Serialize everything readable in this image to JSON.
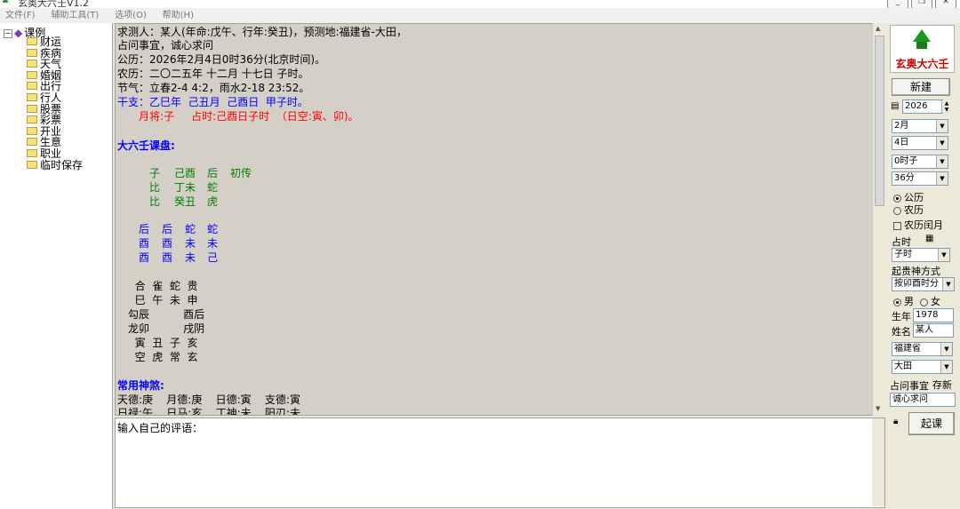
{
  "window": {
    "title": "玄奥大六壬V1.2"
  },
  "menu": {
    "items": [
      "文件(F)",
      "辅助工具(T)",
      "选项(O)",
      "帮助(H)"
    ]
  },
  "tree": {
    "root": "课例",
    "items": [
      "财运",
      "疾病",
      "天气",
      "婚姻",
      "出行",
      "行人",
      "股票",
      "彩票",
      "开业",
      "生意",
      "职业",
      "临时保存"
    ]
  },
  "content": {
    "intro": [
      "求测人：某人(年命:戊午、行年:癸丑)，预测地:福建省-大田，",
      "占问事宜，诚心求问",
      "公历：2026年2月4日0时36分(北京时间)。",
      "农历：二〇二五年 十二月 十七日 子时。",
      "节气：立春2-4 4:2，雨水2-18 23:52。"
    ],
    "ganzhi": "干支：乙巳年  己丑月  己酉日  甲子时。",
    "yuejiang": "月将:子     占时:己酉日子时  （日空:寅、卯)。",
    "pan_title": "大六壬课盘:",
    "chuan": [
      [
        "子",
        "己酉",
        "后",
        "初传"
      ],
      [
        "比",
        "丁未",
        "蛇",
        ""
      ],
      [
        "比",
        "癸丑",
        "虎",
        ""
      ]
    ],
    "ke": [
      [
        "后",
        "后",
        "蛇",
        "蛇"
      ],
      [
        "酉",
        "酉",
        "未",
        "未"
      ],
      [
        "酉",
        "酉",
        "未",
        "己"
      ]
    ],
    "tianpan": [
      "  合  雀  蛇  贵",
      "  巳  午  未  申",
      "勾辰          酉后",
      "龙卯          戌阴",
      "  寅  丑  子  亥",
      "  空  虎  常  玄"
    ],
    "shensha_title": "常用神煞:",
    "shensha": [
      "天德:庚    月德:庚    日德:寅    支德:寅",
      "日禄:午    日马:亥    丁神:未    阳刃:未"
    ]
  },
  "comment": {
    "placeholder_text": "输入自己的评语："
  },
  "panel": {
    "logo_text": "玄奥大六壬",
    "new_button": "新建",
    "year": "2026",
    "month": "2月",
    "day": "4日",
    "hour": "0时子",
    "minute": "36分",
    "calendar_options": [
      "公历",
      "农历"
    ],
    "leap_month_label": "农历闰月",
    "zhanshi_label": "占时",
    "zhanshi_value": "子时",
    "guishen_label": "起贵神方式",
    "guishen_value": "按卯酉时分",
    "gender_options": [
      "男",
      "女"
    ],
    "birth_year_label": "生年",
    "birth_year": "1978",
    "name_label": "姓名",
    "name": "某人",
    "province": "福建省",
    "city": "大田",
    "question_label": "占问事宜",
    "save_label": "存新",
    "question": "诚心求问",
    "start_button": "起课"
  },
  "colors": {
    "logo_green": "#1a9a1a",
    "logo_red": "#d00000",
    "text_blue": "#0000ff",
    "text_red": "#ff0000",
    "text_green": "#008000"
  }
}
